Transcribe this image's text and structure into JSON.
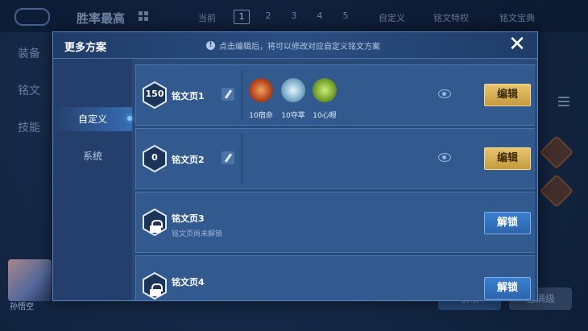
{
  "background": {
    "title": "胜率最高",
    "current_label": "当前",
    "pages": [
      "1",
      "2",
      "3",
      "4",
      "5"
    ],
    "custom_label": "自定义",
    "rune_feature_label": "铭文特权",
    "rune_guide_label": "铭文宝典",
    "left_nav": [
      "装备",
      "铭文",
      "技能"
    ],
    "avatar_name": "孙悟空",
    "buttons": [
      "获取",
      "已满级"
    ]
  },
  "modal": {
    "title": "更多方案",
    "hint": "点击编辑后，将可以修改对应自定义铭文方案",
    "close_label": "✕",
    "tabs": [
      {
        "label": "自定义",
        "active": true
      },
      {
        "label": "系统",
        "active": false
      }
    ],
    "pages": [
      {
        "level": "150",
        "name": "铭文页1",
        "runes": [
          {
            "label": "10宿命",
            "color": "#c9582b"
          },
          {
            "label": "10夺萃",
            "color": "#7fb0c9"
          },
          {
            "label": "10心眼",
            "color": "#7aa531"
          }
        ],
        "action": "编辑",
        "locked": false
      },
      {
        "level": "0",
        "name": "铭文页2",
        "runes": [],
        "action": "编辑",
        "locked": false
      },
      {
        "name": "铭文页3",
        "subtext": "铭文页尚未解锁",
        "action": "解锁",
        "locked": true
      },
      {
        "name": "铭文页4",
        "action": "解锁",
        "locked": true
      }
    ]
  },
  "colors": {
    "edit_button": "#d8b056",
    "unlock_button": "#3574c0",
    "modal_bg": "#2a4a7a"
  }
}
